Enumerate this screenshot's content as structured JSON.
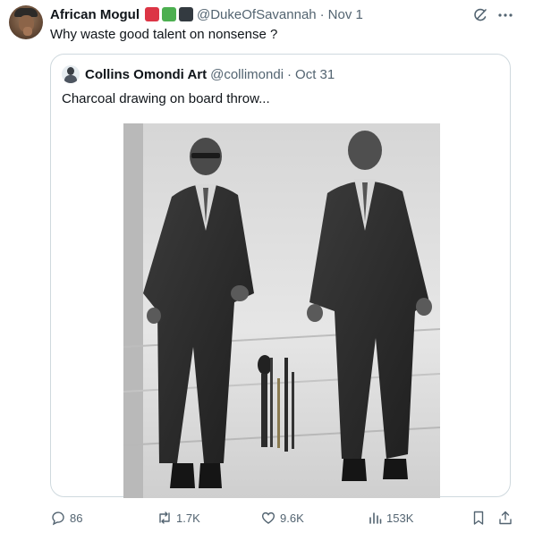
{
  "tweet": {
    "author_name": "African Mogul",
    "flag_colors": [
      "#dc3545",
      "#4caf50",
      "#333a40"
    ],
    "handle": "@DukeOfSavannah",
    "separator": "·",
    "date": "Nov 1",
    "text": "Why waste good talent on nonsense ?",
    "icons": {
      "grok": "grok-icon",
      "more": "more-icon"
    }
  },
  "quote": {
    "author_name": "Collins Omondi Art",
    "handle": "@collimondi",
    "separator": "·",
    "date": "Oct 31",
    "text": "Charcoal drawing on board throw...",
    "image_icon": "charcoal-drawing-image"
  },
  "actions": {
    "replies": "86",
    "reposts": "1.7K",
    "likes": "9.6K",
    "views": "153K"
  },
  "colors": {
    "text": "#0f1419",
    "secondary": "#536471",
    "border": "#cfd9de"
  }
}
